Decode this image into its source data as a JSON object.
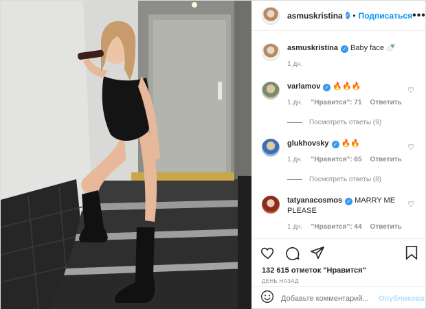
{
  "author": {
    "username": "asmuskristina",
    "follow_label": "Подписаться",
    "dot": "•",
    "more_label": "•••"
  },
  "caption": {
    "username": "asmuskristina",
    "text": "Baby face 🍼",
    "time": "1 дн."
  },
  "comments": [
    {
      "username": "varlamov",
      "text": "🔥🔥🔥",
      "time": "1 дн.",
      "likes": "\"Нравится\": 71",
      "reply": "Ответить",
      "view_replies": "Посмотреть ответы (9)"
    },
    {
      "username": "glukhovsky",
      "text": "🔥🔥",
      "time": "1 дн.",
      "likes": "\"Нравится\": 65",
      "reply": "Ответить",
      "view_replies": "Посмотреть ответы (8)"
    },
    {
      "username": "tatyanacosmos",
      "text": "MARRY ME PLEASE",
      "time": "1 дн.",
      "likes": "\"Нравится\": 44",
      "reply": "Ответить"
    }
  ],
  "stats": {
    "likes": "132 615 отметок \"Нравится\"",
    "posted": "ДЕНЬ НАЗАД"
  },
  "add_comment": {
    "placeholder": "Добавьте комментарий...",
    "publish": "Опубликовать"
  },
  "colors": {
    "accent": "#0095f6",
    "verified": "#3897f0",
    "muted": "#8e8e8e"
  }
}
